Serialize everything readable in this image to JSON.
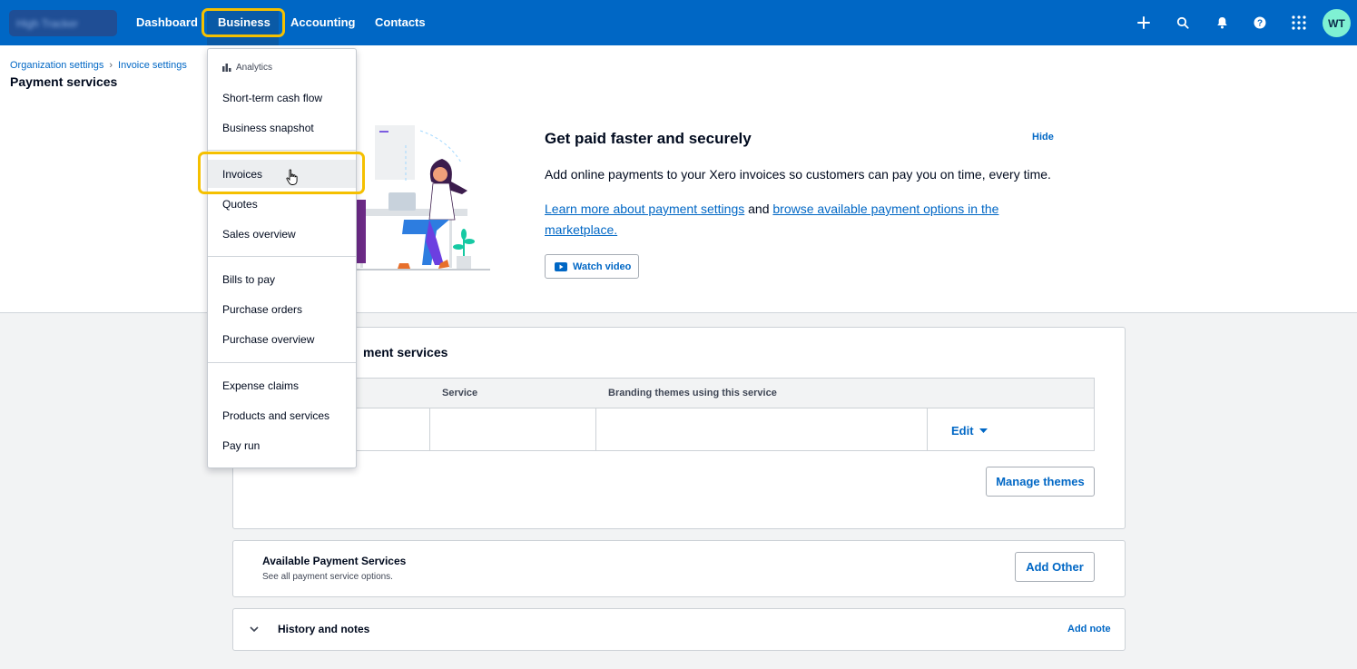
{
  "topbar": {
    "org_name": "High Tracker",
    "nav": [
      "Dashboard",
      "Business",
      "Accounting",
      "Contacts"
    ],
    "avatar_initials": "WT",
    "icons": [
      "plus-icon",
      "search-icon",
      "bell-icon",
      "help-icon",
      "apps-grid-icon"
    ]
  },
  "breadcrumb": {
    "items": [
      "Organization settings",
      "Invoice settings"
    ],
    "separator": "›"
  },
  "page_title": "Payment services",
  "promo": {
    "title": "Get paid faster and securely",
    "hide_label": "Hide",
    "description": "Add online payments to your Xero invoices so customers can pay you on time, every time.",
    "link1": "Learn more about payment settings",
    "link_joiner": " and ",
    "link2": "browse available payment options in the marketplace.",
    "watch_label": "Watch video"
  },
  "payment_services_card": {
    "title_visible": "ment services",
    "columns": [
      "Service",
      "Branding themes using this service"
    ],
    "edit_label": "Edit",
    "manage_label": "Manage themes"
  },
  "available_card": {
    "title": "Available Payment Services",
    "subtitle": "See all payment service options.",
    "button": "Add Other"
  },
  "history_card": {
    "title": "History and notes",
    "add_note": "Add note"
  },
  "business_menu": {
    "section_label": "Analytics",
    "groups": [
      [
        "Short-term cash flow",
        "Business snapshot"
      ],
      [
        "Invoices",
        "Quotes",
        "Sales overview"
      ],
      [
        "Bills to pay",
        "Purchase orders",
        "Purchase overview"
      ],
      [
        "Expense claims",
        "Products and services",
        "Pay run"
      ]
    ]
  },
  "colors": {
    "nav_bg": "#0067c5",
    "highlight_ring": "#f5c000",
    "link": "#0067c5",
    "avatar_bg": "#7ff1d3"
  }
}
